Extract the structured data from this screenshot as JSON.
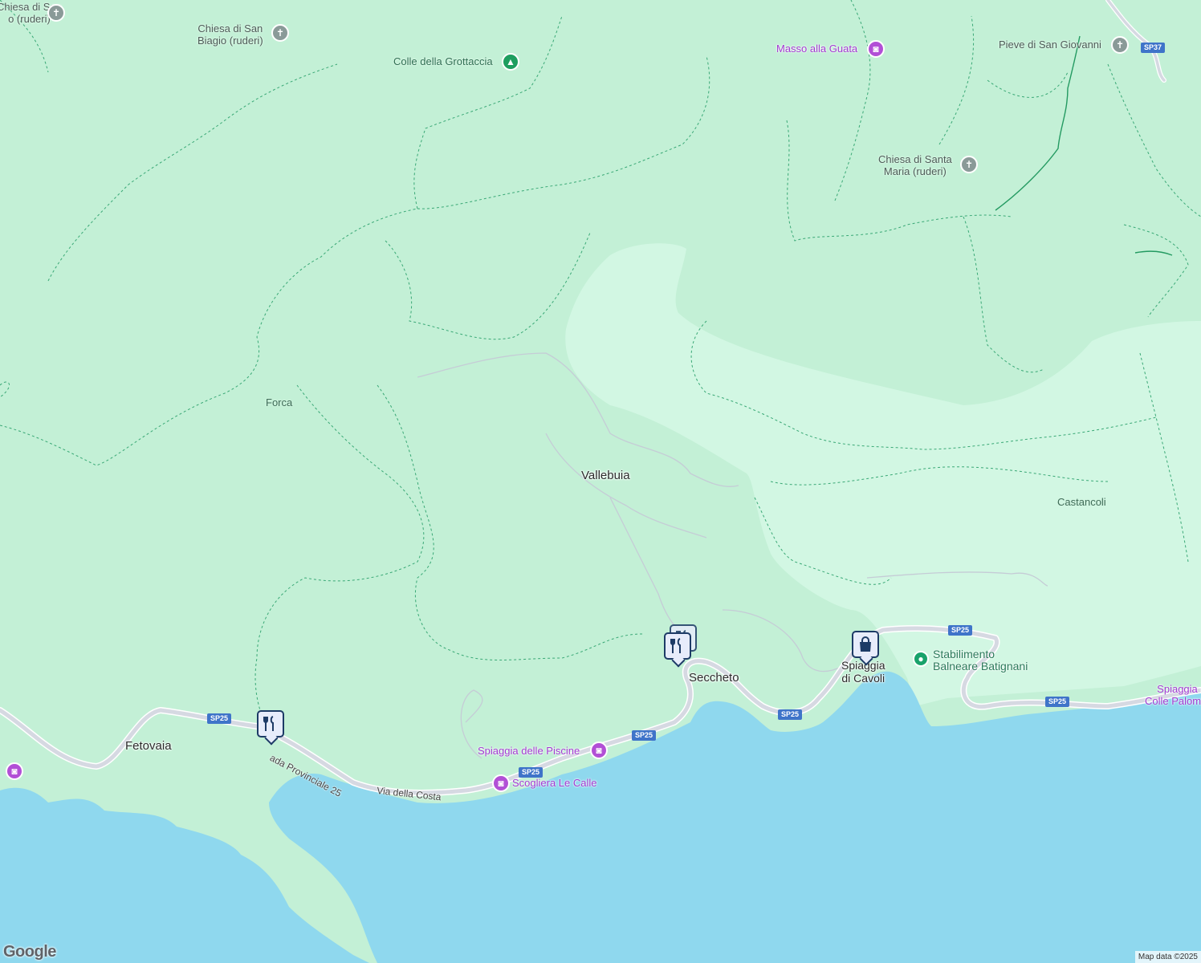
{
  "map": {
    "towns": {
      "vallebuia": "Vallebuia",
      "seccheto": "Seccheto",
      "fetovaia": "Fetovaia",
      "spiaggia_cavoli": "Spiaggia\ndi Cavoli",
      "spiaggia_colle_palombaia": "Spiaggia di\nColle Palombaia"
    },
    "areas": {
      "forca": "Forca",
      "castancoli": "Castancoli"
    },
    "churches": {
      "san_biagio": "Chiesa di San\nBiagio (ruderi)",
      "santa_maria": "Chiesa di Santa\nMaria (ruderi)",
      "pieve_san_giovanni": "Pieve di San Giovanni",
      "corner": "Chiesa di San\no (ruderi)"
    },
    "parks": {
      "colle_grottaccia": "Colle della Grottaccia"
    },
    "pois": {
      "masso_guata": "Masso alla Guata",
      "spiaggia_piscine": "Spiaggia delle Piscine",
      "scogliera_calle": "Scogliera Le Calle",
      "stabilimento": "Stabilimento\nBalneare Batignani"
    },
    "roads": {
      "strada_provinciale": "ada Provinciale 25",
      "via_costa": "Via della Costa",
      "sp25": "SP25",
      "sp37": "SP37"
    },
    "icons": {
      "restaurant": "restaurant-icon",
      "shopping": "shopping-bag-icon",
      "camera": "camera-icon",
      "cross": "cross-icon",
      "tree": "tree-icon"
    },
    "colors": {
      "land": "#c3f0d6",
      "light_land": "#d2f7e3",
      "sea": "#8fd8ee",
      "trail": "#3aa876",
      "road": "#d6d9e2",
      "poi_purple": "#b24fd6",
      "marker_navy": "#1d3b66"
    }
  },
  "footer": {
    "attribution": "Map data ©2025",
    "logo": "Google"
  }
}
